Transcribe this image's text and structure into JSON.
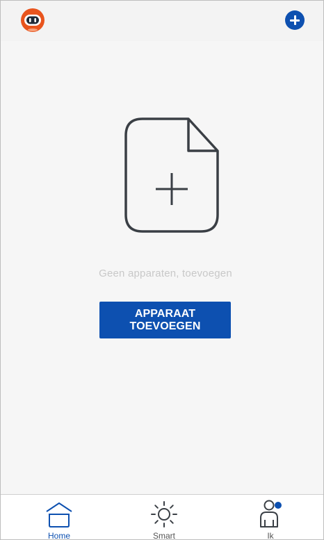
{
  "header": {
    "avatar_icon": "robot-icon",
    "add_icon": "plus-circle-icon"
  },
  "empty_state": {
    "icon": "file-plus-icon",
    "message": "Geen apparaten, toevoegen",
    "button_label": "APPARAAT TOEVOEGEN"
  },
  "tabbar": {
    "tabs": [
      {
        "label": "Home",
        "icon": "house-icon",
        "active": true
      },
      {
        "label": "Smart",
        "icon": "sun-icon",
        "active": false
      },
      {
        "label": "Ik",
        "icon": "person-icon",
        "active": false
      }
    ]
  },
  "colors": {
    "accent": "#0d50b0",
    "avatar_orange": "#e8541d",
    "placeholder_text": "#c8c8c8",
    "icon_gray": "#3a3f45"
  }
}
